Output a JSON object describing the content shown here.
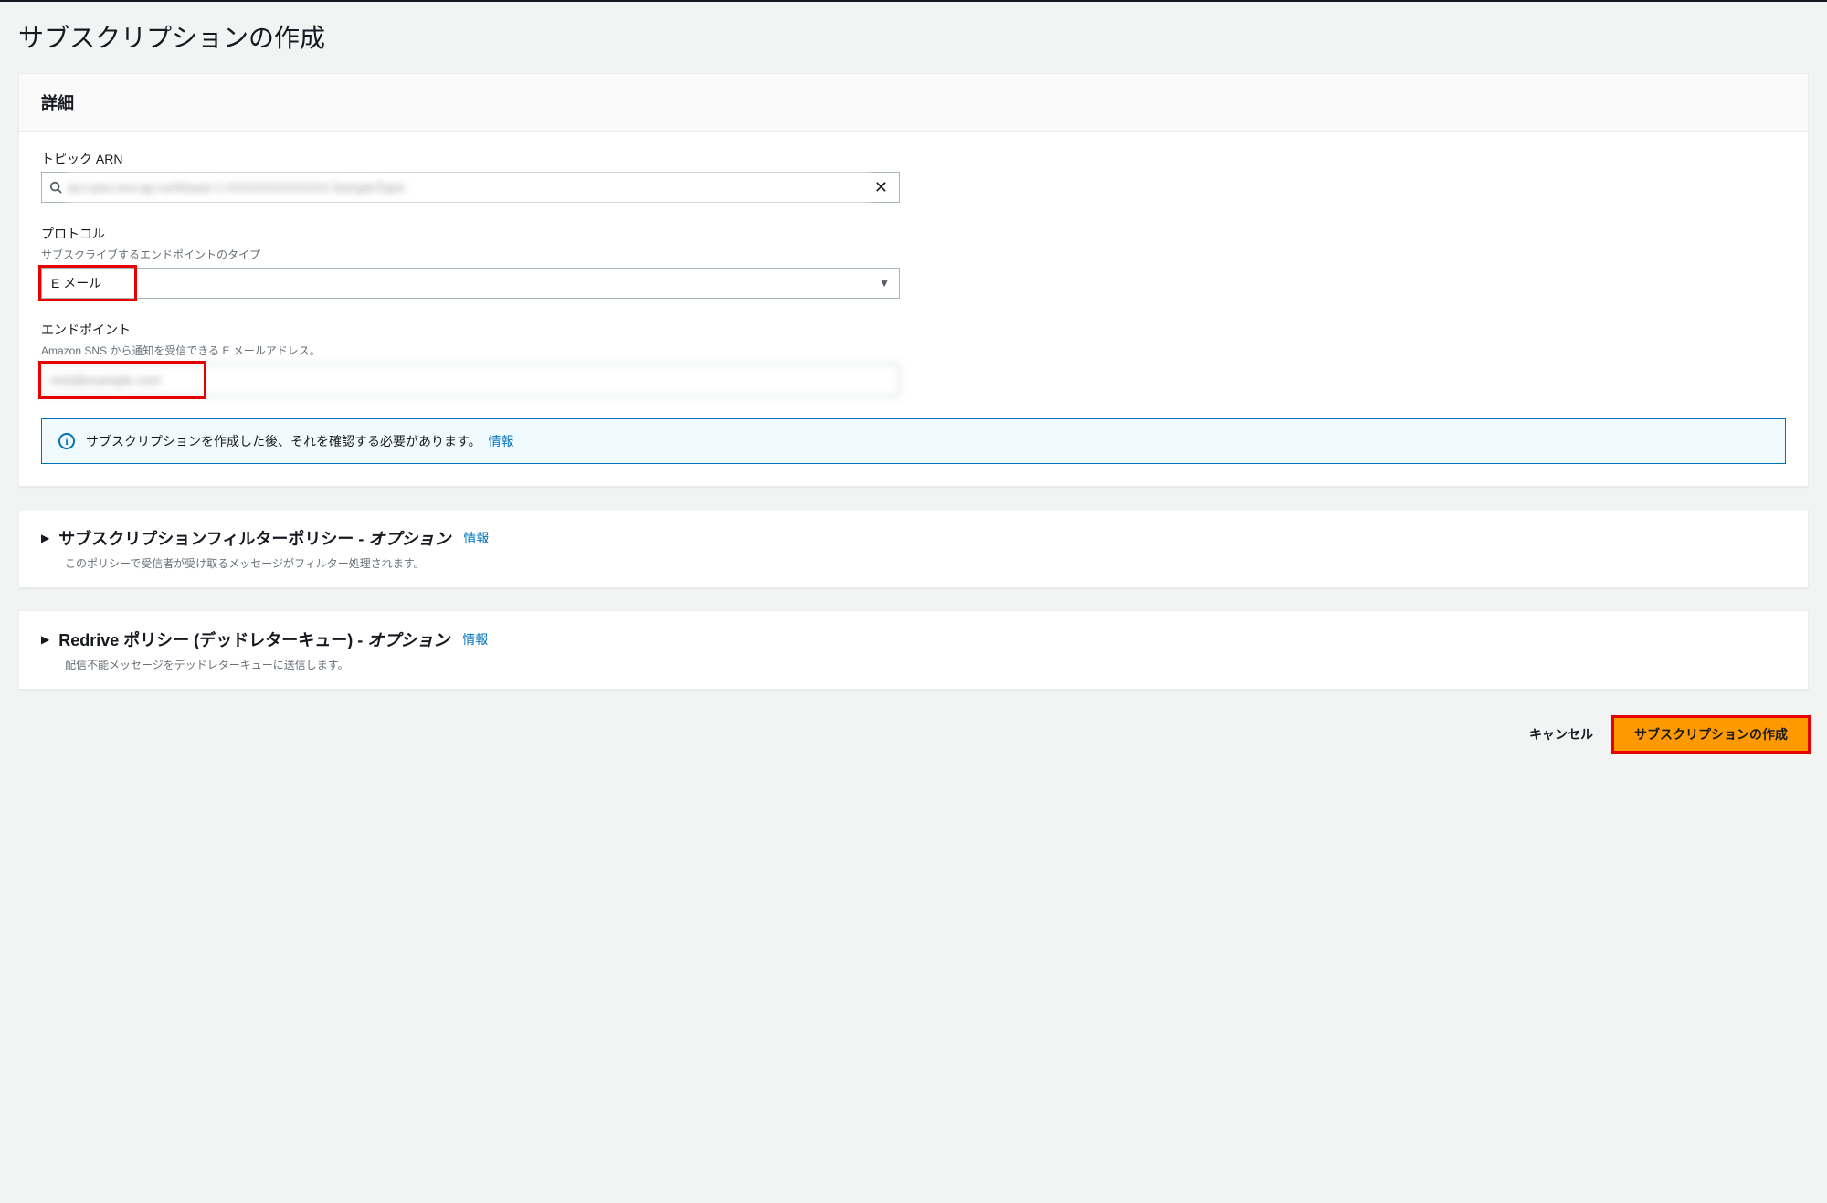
{
  "page": {
    "title": "サブスクリプションの作成"
  },
  "details": {
    "heading": "詳細",
    "topic_arn": {
      "label": "トピック ARN",
      "value": "arn:aws:sns:ap-northeast-1:XXXXXXXXXXXX:SampleTopic"
    },
    "protocol": {
      "label": "プロトコル",
      "hint": "サブスクライブするエンドポイントのタイプ",
      "selected": "E メール"
    },
    "endpoint": {
      "label": "エンドポイント",
      "hint": "Amazon SNS から通知を受信できる E メールアドレス。",
      "value": "test@example.com"
    },
    "info_banner": {
      "text": "サブスクリプションを作成した後、それを確認する必要があります。",
      "link": "情報"
    }
  },
  "filter_policy": {
    "title_main": "サブスクリプションフィルターポリシー - ",
    "title_opt": "オプション",
    "info_link": "情報",
    "description": "このポリシーで受信者が受け取るメッセージがフィルター処理されます。"
  },
  "redrive_policy": {
    "title_main": "Redrive ポリシー (デッドレターキュー) - ",
    "title_opt": "オプション",
    "info_link": "情報",
    "description": "配信不能メッセージをデッドレターキューに送信します。"
  },
  "footer": {
    "cancel": "キャンセル",
    "create": "サブスクリプションの作成"
  }
}
